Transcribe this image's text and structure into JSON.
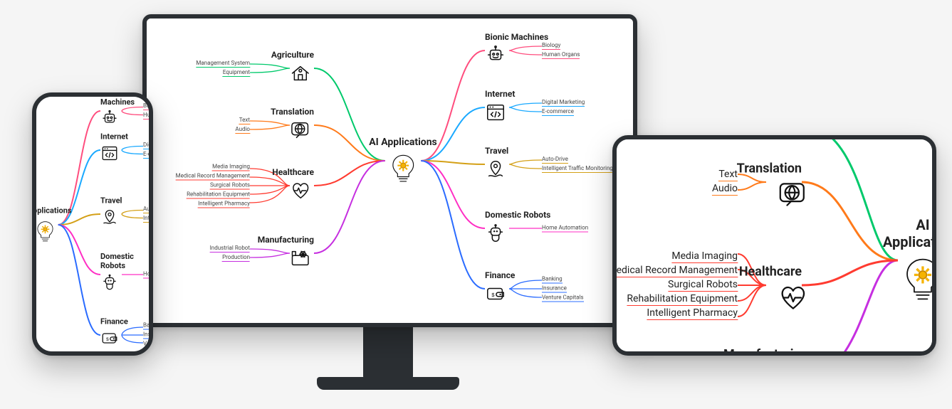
{
  "mindmap": {
    "title": "AI Applications",
    "center_icon": "lightbulb-gear",
    "left_branches": [
      {
        "title": "Agriculture",
        "icon": "farm-house-icon",
        "color": "#00c96b",
        "leaves": [
          "Management System",
          "Equipment"
        ]
      },
      {
        "title": "Translation",
        "icon": "globe-speech-icon",
        "color": "#ff7a1a",
        "leaves": [
          "Text",
          "Audio"
        ]
      },
      {
        "title": "Healthcare",
        "icon": "heart-pulse-icon",
        "color": "#ff3b30",
        "leaves": [
          "Media Imaging",
          "Medical Record Management",
          "Surgical Robots",
          "Rehabilitation Equipment",
          "Intelligent Pharmacy"
        ]
      },
      {
        "title": "Manufacturing",
        "icon": "factory-gear-icon",
        "color": "#c62fe0",
        "leaves": [
          "Industrial Robot",
          "Production"
        ]
      }
    ],
    "right_branches": [
      {
        "title": "Bionic Machines",
        "icon": "robot-icon",
        "color": "#ff4d7e",
        "leaves": [
          "Biology",
          "Human Organs"
        ]
      },
      {
        "title": "Internet",
        "icon": "code-window-icon",
        "color": "#1aa9ff",
        "leaves": [
          "Digital Marketing",
          "E-commerce"
        ]
      },
      {
        "title": "Travel",
        "icon": "route-pin-icon",
        "color": "#d4a017",
        "leaves": [
          "Auto-Drive",
          "Intelligent Traffic Monitoring"
        ]
      },
      {
        "title": "Domestic Robots",
        "icon": "home-robot-icon",
        "color": "#ff2ec4",
        "leaves": [
          "Home Automation"
        ]
      },
      {
        "title": "Finance",
        "icon": "wallet-money-icon",
        "color": "#2b6cff",
        "leaves": [
          "Banking",
          "Insurance",
          "Venture Capitals"
        ]
      }
    ]
  },
  "devices": {
    "desktop": "desktop-monitor",
    "phone": "smartphone",
    "tablet": "tablet-landscape"
  }
}
